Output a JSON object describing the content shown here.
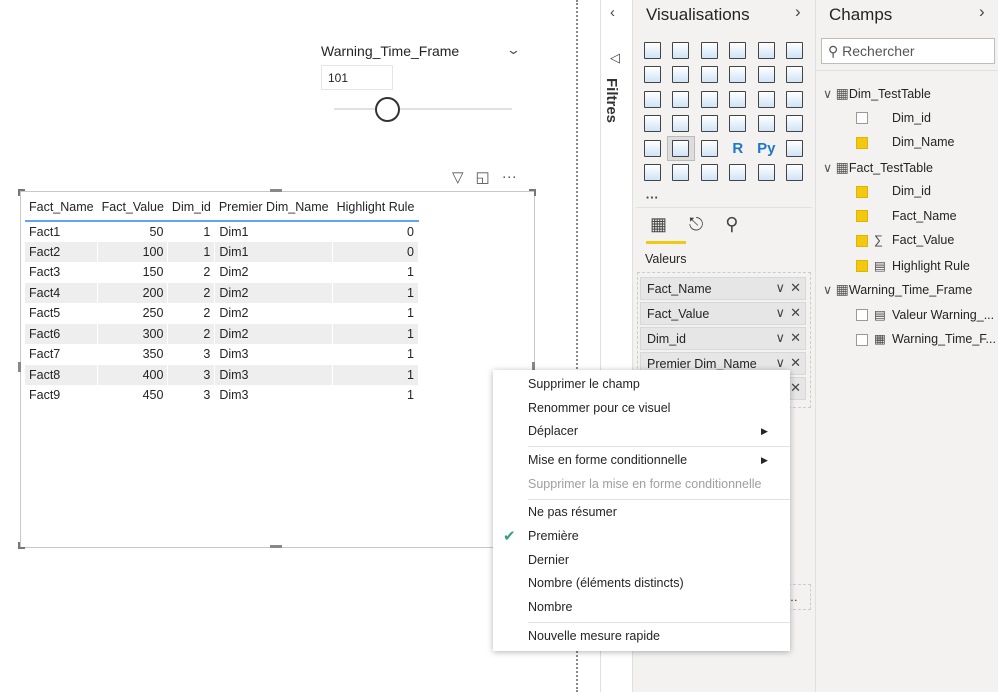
{
  "slicer": {
    "title": "Warning_Time_Frame",
    "value": "101",
    "slider_position": 0.3
  },
  "table": {
    "columns": [
      "Fact_Name",
      "Fact_Value",
      "Dim_id",
      "Premier Dim_Name",
      "Highlight Rule"
    ],
    "rows": [
      [
        "Fact1",
        "50",
        "1",
        "Dim1",
        "0"
      ],
      [
        "Fact2",
        "100",
        "1",
        "Dim1",
        "0"
      ],
      [
        "Fact3",
        "150",
        "2",
        "Dim2",
        "1"
      ],
      [
        "Fact4",
        "200",
        "2",
        "Dim2",
        "1"
      ],
      [
        "Fact5",
        "250",
        "2",
        "Dim2",
        "1"
      ],
      [
        "Fact6",
        "300",
        "2",
        "Dim2",
        "1"
      ],
      [
        "Fact7",
        "350",
        "3",
        "Dim3",
        "1"
      ],
      [
        "Fact8",
        "400",
        "3",
        "Dim3",
        "1"
      ],
      [
        "Fact9",
        "450",
        "3",
        "Dim3",
        "1"
      ]
    ],
    "header_underline_color": "#5ea6f0"
  },
  "filters": {
    "label": "Filtres"
  },
  "visualizations": {
    "title": "Visualisations",
    "icons": [
      "stacked-bar",
      "stacked-column",
      "clustered-bar",
      "clustered-column",
      "100-bar",
      "100-column",
      "line",
      "area",
      "stacked-area",
      "line-column",
      "line-clustered-column",
      "ribbon",
      "waterfall",
      "funnel",
      "scatter",
      "pie",
      "donut",
      "treemap",
      "map",
      "filled-map",
      "gauge",
      "card",
      "multi-row-card",
      "kpi",
      "slicer",
      "table",
      "matrix",
      "R",
      "Py",
      "key-influencers",
      "decomposition-tree",
      "qa",
      "paginated",
      "smart-narrative",
      "power-apps",
      "power-automate",
      "more"
    ],
    "r_label": "R",
    "py_label": "Py",
    "more_label": "···",
    "wells_label": "Valeurs",
    "wells": [
      "Fact_Name",
      "Fact_Value",
      "Dim_id",
      "Premier Dim_Name"
    ],
    "accent": "#f2c811"
  },
  "fields": {
    "title": "Champs",
    "search_placeholder": "Rechercher",
    "tables": [
      {
        "name": "Dim_TestTable",
        "items": [
          {
            "name": "Dim_id",
            "checked": false,
            "icon": ""
          },
          {
            "name": "Dim_Name",
            "checked": true,
            "icon": ""
          }
        ]
      },
      {
        "name": "Fact_TestTable",
        "items": [
          {
            "name": "Dim_id",
            "checked": true,
            "icon": ""
          },
          {
            "name": "Fact_Name",
            "checked": true,
            "icon": ""
          },
          {
            "name": "Fact_Value",
            "checked": true,
            "icon": "sigma"
          },
          {
            "name": "Highlight Rule",
            "checked": true,
            "icon": "calculator"
          }
        ]
      },
      {
        "name": "Warning_Time_Frame",
        "items": [
          {
            "name": "Valeur Warning_...",
            "checked": false,
            "icon": "calculator"
          },
          {
            "name": "Warning_Time_F...",
            "checked": false,
            "icon": "parameter"
          }
        ]
      }
    ]
  },
  "context_menu": {
    "items": [
      "Supprimer le champ",
      "Renommer pour ce visuel",
      "Déplacer",
      "Mise en forme conditionnelle",
      "Supprimer la mise en forme conditionnelle",
      "Ne pas résumer",
      "Première",
      "Dernier",
      "Nombre (éléments distincts)",
      "Nombre",
      "Nouvelle mesure rapide"
    ],
    "checked": "Première",
    "check_color": "#3a9e84"
  }
}
